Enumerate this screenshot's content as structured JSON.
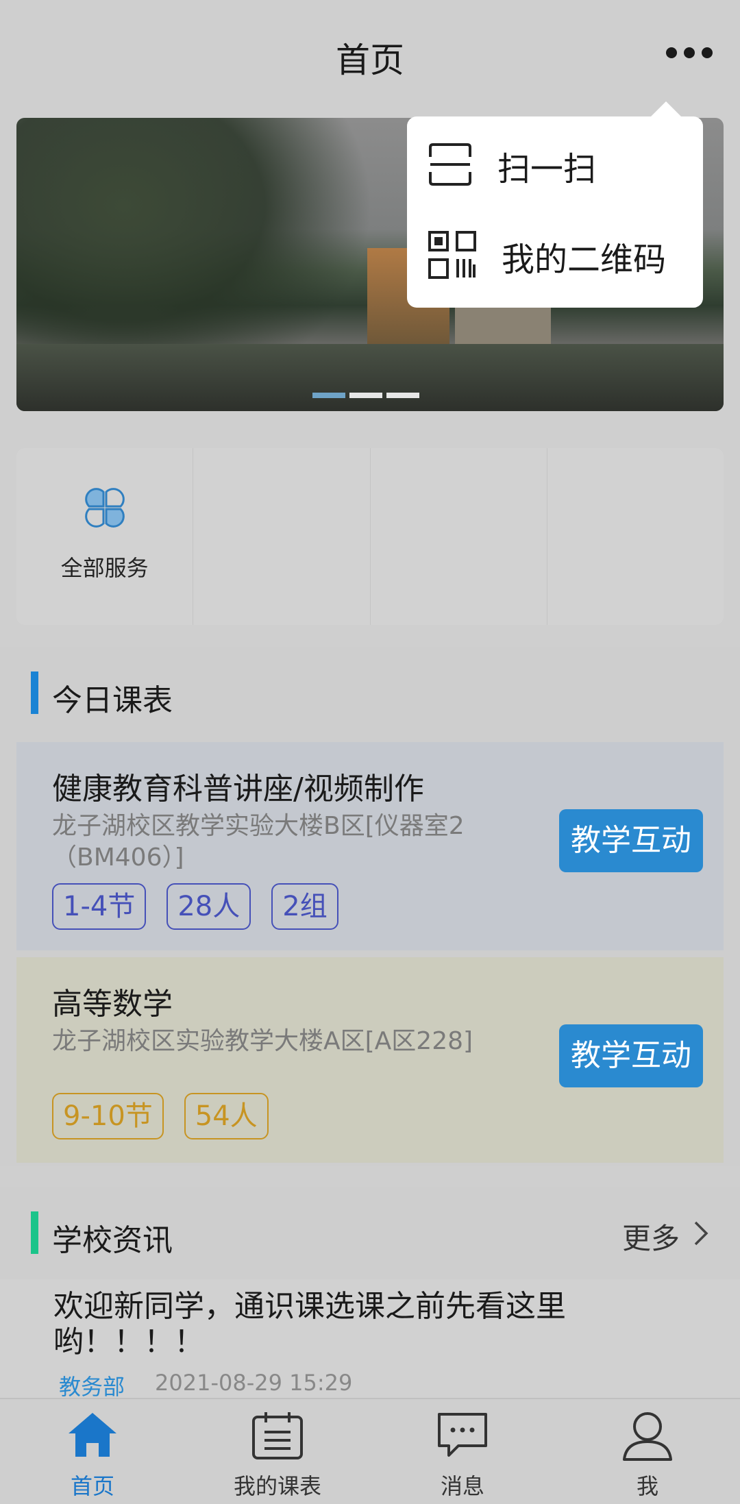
{
  "header": {
    "title": "首页"
  },
  "dropdown": {
    "items": [
      {
        "label": "扫一扫",
        "icon": "scan-icon"
      },
      {
        "label": "我的二维码",
        "icon": "qr-code-icon"
      }
    ]
  },
  "services": {
    "all_label": "全部服务"
  },
  "today": {
    "title": "今日课表",
    "accent": "#1a83d4",
    "courses": [
      {
        "name": "健康教育科普讲座/视频制作",
        "location": "龙子湖校区教学实验大楼B区[仪器室2（BM406）]",
        "tags": [
          "1-4节",
          "28人",
          "2组"
        ],
        "button": "教学互动"
      },
      {
        "name": "高等数学",
        "location": "龙子湖校区实验教学大楼A区[A区228]",
        "tags": [
          "9-10节",
          "54人"
        ],
        "button": "教学互动"
      }
    ]
  },
  "news": {
    "title": "学校资讯",
    "accent": "#1bc48a",
    "more_label": "更多",
    "items": [
      {
        "headline": "欢迎新同学，通识课选课之前先看这里哟！！！！",
        "source": "教务部",
        "time": "2021-08-29 15:29"
      }
    ]
  },
  "tabbar": {
    "items": [
      {
        "label": "首页",
        "icon": "home-icon",
        "active": true
      },
      {
        "label": "我的课表",
        "icon": "calendar-icon",
        "active": false
      },
      {
        "label": "消息",
        "icon": "message-icon",
        "active": false
      },
      {
        "label": "我",
        "icon": "user-icon",
        "active": false
      }
    ]
  }
}
